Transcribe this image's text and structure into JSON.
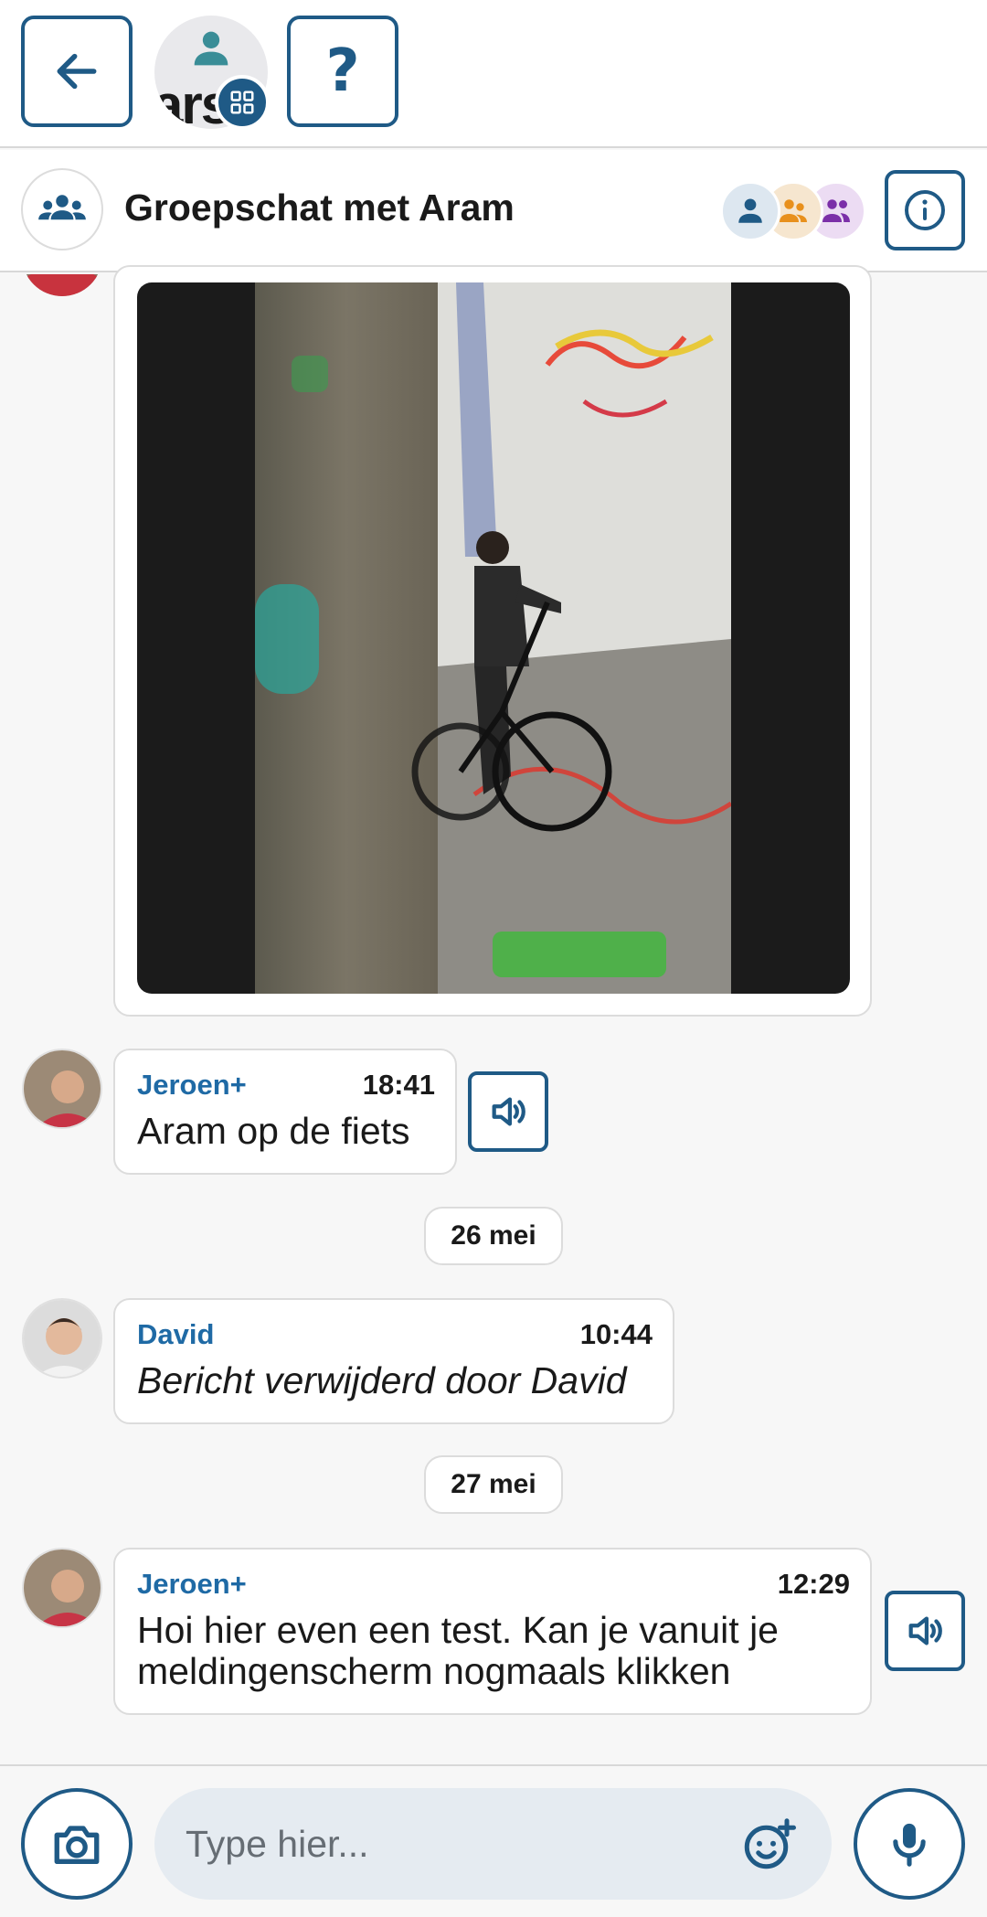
{
  "app": {
    "logo_text": "ars"
  },
  "topbar": {
    "help_label": "?"
  },
  "chat": {
    "title": "Groepschat met Aram",
    "participant_colors": [
      "#1f5a86",
      "#e8901c",
      "#7b2fa8"
    ]
  },
  "messages": [
    {
      "type": "image",
      "description_icon": "photo-bmx-rider"
    },
    {
      "sender": "Jeroen+",
      "time": "18:41",
      "text": "Aram op de fiets"
    },
    {
      "date": "26 mei"
    },
    {
      "sender": "David",
      "time": "10:44",
      "text": "Bericht verwijderd door David",
      "deleted": true
    },
    {
      "date": "27 mei"
    },
    {
      "sender": "Jeroen+",
      "time": "12:29",
      "text": "Hoi hier even een test. Kan je vanuit je meldingenscherm nogmaals klikken"
    }
  ],
  "composer": {
    "placeholder": "Type hier..."
  },
  "colors": {
    "accent": "#1f5a86",
    "sender": "#1f6aa5"
  }
}
